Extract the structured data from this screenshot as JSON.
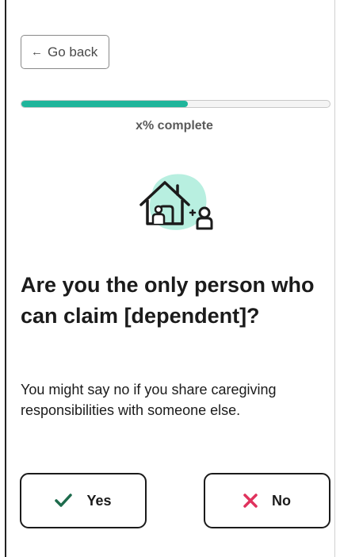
{
  "nav": {
    "back_label": "Go back",
    "back_icon": "arrow-left-icon"
  },
  "progress": {
    "label": "x% complete",
    "fill_fraction": 0.54,
    "color": "#1fb59b"
  },
  "illustration": {
    "icon": "house-with-dependents-icon",
    "accent_color": "#b8efe0"
  },
  "question": {
    "title": "Are you the only person who can claim [dependent]?",
    "description": "You might say no if you share caregiving responsibilities with someone else."
  },
  "answers": {
    "yes": {
      "label": "Yes",
      "icon": "checkmark-icon",
      "icon_color": "#1d6b4c"
    },
    "no": {
      "label": "No",
      "icon": "x-icon",
      "icon_color": "#e0325d"
    }
  }
}
